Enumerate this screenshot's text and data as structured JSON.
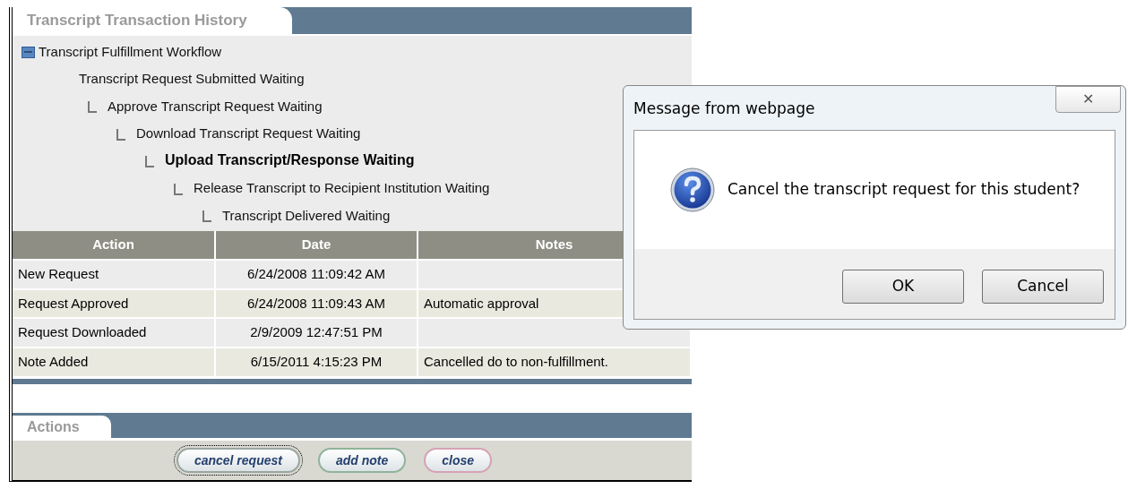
{
  "history_tab": {
    "label": "Transcript Transaction History"
  },
  "workflow": {
    "label": "Transcript Fulfillment Workflow",
    "expanded": true,
    "children": [
      {
        "label": "Transcript Request Submitted Waiting",
        "current": false,
        "children": [
          {
            "label": "Approve Transcript Request Waiting",
            "current": false,
            "children": [
              {
                "label": "Download Transcript Request Waiting",
                "current": false,
                "children": [
                  {
                    "label": "Upload Transcript/Response Waiting",
                    "current": true,
                    "children": [
                      {
                        "label": "Release Transcript to Recipient Institution Waiting",
                        "current": false,
                        "children": [
                          {
                            "label": "Transcript Delivered Waiting",
                            "current": false
                          }
                        ]
                      }
                    ]
                  }
                ]
              }
            ]
          }
        ]
      }
    ]
  },
  "table": {
    "columns": [
      "Action",
      "Date",
      "Notes"
    ],
    "rows": [
      [
        "New Request",
        "6/24/2008 11:09:42 AM",
        ""
      ],
      [
        "Request Approved",
        "6/24/2008 11:09:43 AM",
        "Automatic approval"
      ],
      [
        "Request Downloaded",
        "2/9/2009 12:47:51 PM",
        ""
      ],
      [
        "Note Added",
        "6/15/2011 4:15:23 PM",
        "Cancelled do to non-fulfillment."
      ]
    ]
  },
  "actions_tab": {
    "label": "Actions"
  },
  "actions": [
    {
      "label": "cancel request",
      "kind": "neutral",
      "focused": true
    },
    {
      "label": "add note",
      "kind": "green",
      "focused": false
    },
    {
      "label": "close",
      "kind": "red",
      "focused": false
    }
  ],
  "dialog": {
    "title": "Message from webpage",
    "close": "✕",
    "message": "Cancel the transcript request for this student?",
    "buttons": [
      "OK",
      "Cancel"
    ]
  }
}
